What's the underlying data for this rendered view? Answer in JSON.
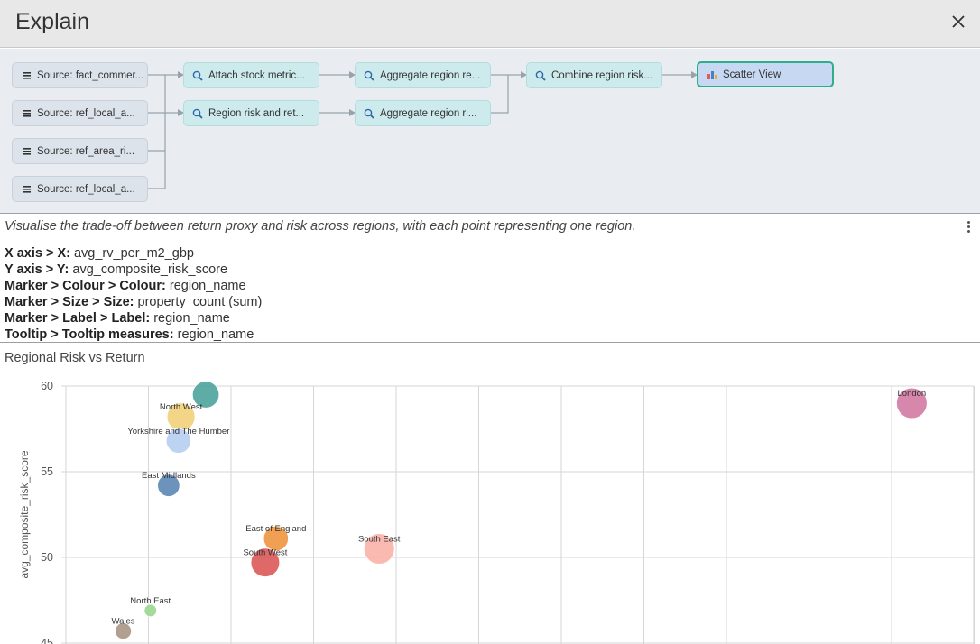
{
  "header": {
    "title": "Explain",
    "close_label": "×"
  },
  "pipeline": {
    "nodes": [
      {
        "id": "s1",
        "kind": "src",
        "label": "Source: fact_commer...",
        "icon": "table-icon"
      },
      {
        "id": "s2",
        "kind": "src",
        "label": "Source: ref_local_a...",
        "icon": "table-icon"
      },
      {
        "id": "s3",
        "kind": "src",
        "label": "Source: ref_area_ri...",
        "icon": "table-icon"
      },
      {
        "id": "s4",
        "kind": "src",
        "label": "Source: ref_local_a...",
        "icon": "table-icon"
      },
      {
        "id": "t1",
        "kind": "xf",
        "label": "Attach stock metric...",
        "icon": "magnifier-icon"
      },
      {
        "id": "t2",
        "kind": "xf",
        "label": "Region risk and ret...",
        "icon": "magnifier-icon"
      },
      {
        "id": "t3",
        "kind": "xf",
        "label": "Aggregate region re...",
        "icon": "magnifier-icon"
      },
      {
        "id": "t4",
        "kind": "xf",
        "label": "Aggregate region ri...",
        "icon": "magnifier-icon"
      },
      {
        "id": "t5",
        "kind": "xf",
        "label": "Combine region risk...",
        "icon": "magnifier-icon"
      },
      {
        "id": "v1",
        "kind": "view",
        "label": "Scatter View",
        "icon": "bar-chart-icon"
      }
    ]
  },
  "description": "Visualise the trade-off between return proxy and risk across regions, with each point representing one region.",
  "mappings": [
    {
      "key": "X axis > X:",
      "value": "avg_rv_per_m2_gbp"
    },
    {
      "key": "Y axis > Y:",
      "value": "avg_composite_risk_score"
    },
    {
      "key": "Marker > Colour > Colour:",
      "value": "region_name"
    },
    {
      "key": "Marker > Size > Size:",
      "value": "property_count (sum)"
    },
    {
      "key": "Marker > Label > Label:",
      "value": "region_name"
    },
    {
      "key": "Tooltip > Tooltip measures:",
      "value": "region_name"
    }
  ],
  "chart_title": "Regional Risk vs Return",
  "chart_data": {
    "type": "scatter",
    "title": "Regional Risk vs Return",
    "xlabel": "",
    "ylabel": "avg_composite_risk_score",
    "yticks": [
      45,
      50,
      55,
      60
    ],
    "ylim": [
      45,
      60
    ],
    "grid": true,
    "points": [
      {
        "label": "",
        "x": 0.7,
        "y": 59.5,
        "size": 3.0,
        "color": "#4ba39c"
      },
      {
        "label": "North West",
        "x": 0.4,
        "y": 58.2,
        "size": 3.2,
        "color": "#f2d07a"
      },
      {
        "label": "Yorkshire and The Humber",
        "x": 0.37,
        "y": 56.8,
        "size": 2.7,
        "color": "#b5cff0"
      },
      {
        "label": "East Midlands",
        "x": 0.25,
        "y": 54.2,
        "size": 2.3,
        "color": "#5b87b5"
      },
      {
        "label": "East of England",
        "x": 1.55,
        "y": 51.1,
        "size": 2.7,
        "color": "#ef9540"
      },
      {
        "label": "South West",
        "x": 1.42,
        "y": 49.7,
        "size": 3.3,
        "color": "#dc5959"
      },
      {
        "label": "South East",
        "x": 2.8,
        "y": 50.5,
        "size": 3.6,
        "color": "#f9b3aa"
      },
      {
        "label": "London",
        "x": 9.25,
        "y": 59.0,
        "size": 3.6,
        "color": "#d47aa3"
      },
      {
        "label": "North East",
        "x": 0.03,
        "y": 46.9,
        "size": 0.8,
        "color": "#9bd68f"
      },
      {
        "label": "Wales",
        "x": -0.3,
        "y": 45.7,
        "size": 1.4,
        "color": "#a89684"
      }
    ]
  }
}
